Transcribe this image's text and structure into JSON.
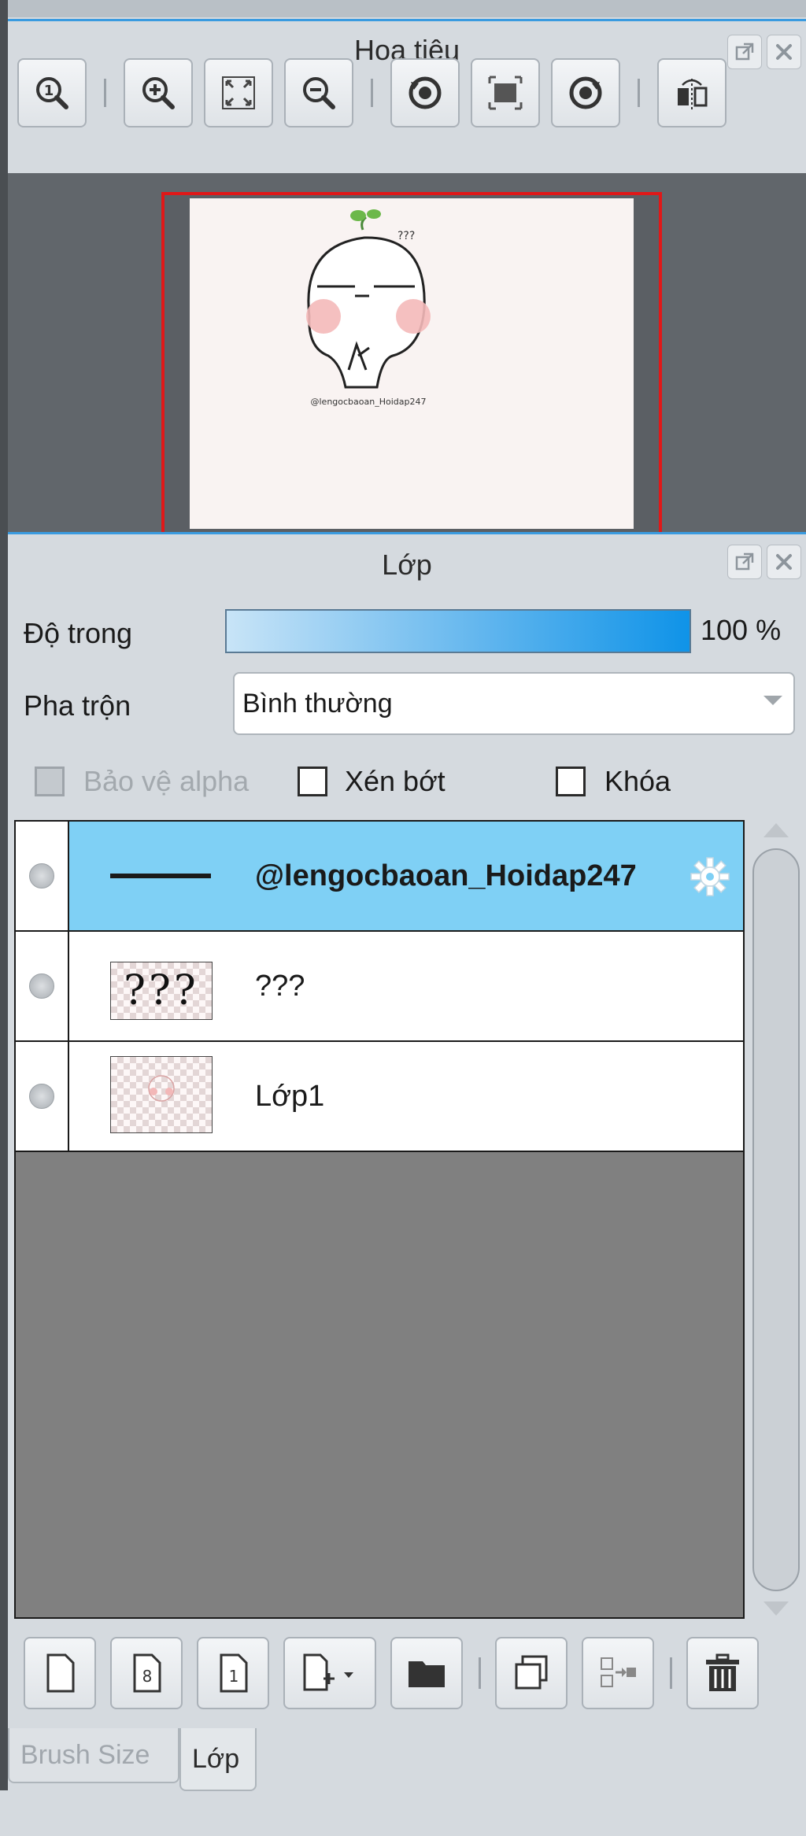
{
  "navigator": {
    "title": "Hoa tiêu",
    "buttons": {
      "float": "float-window-icon",
      "close": "close-icon"
    },
    "tools": [
      "zoom-actual-size-icon",
      "zoom-in-icon",
      "fit-to-window-icon",
      "zoom-out-icon",
      "rotate-left-icon",
      "reset-view-icon",
      "rotate-right-icon",
      "flip-horizontal-icon"
    ],
    "preview_caption": "@lengocbaoan_Hoidap247",
    "preview_text_question": "???"
  },
  "layers": {
    "title": "Lớp",
    "opacity_label": "Độ trong",
    "opacity_value": "100 %",
    "opacity_fraction": 1.0,
    "blend_label": "Pha trộn",
    "blend_value": "Bình thường",
    "protect_alpha_label": "Bảo vệ alpha",
    "clip_label": "Xén bớt",
    "lock_label": "Khóa",
    "items": [
      {
        "name": "@lengocbaoan_Hoidap247",
        "selected": true
      },
      {
        "name": "???",
        "selected": false
      },
      {
        "name": "Lớp1",
        "selected": false
      }
    ],
    "bottom_tools": [
      "new-layer-icon",
      "new-8bit-layer-icon",
      "new-1bit-layer-icon",
      "add-layer-menu-icon",
      "new-folder-icon",
      "duplicate-layer-icon",
      "merge-down-icon",
      "delete-layer-icon"
    ],
    "thumb_question": "???"
  },
  "tabs": [
    {
      "label": "Brush Size",
      "active": false
    },
    {
      "label": "Lớp",
      "active": true
    }
  ],
  "colors": {
    "accent": "#3a9be0",
    "selection": "#7fd0f5",
    "preview_border": "#e01818",
    "canvas_bg": "#f9f3f2"
  }
}
